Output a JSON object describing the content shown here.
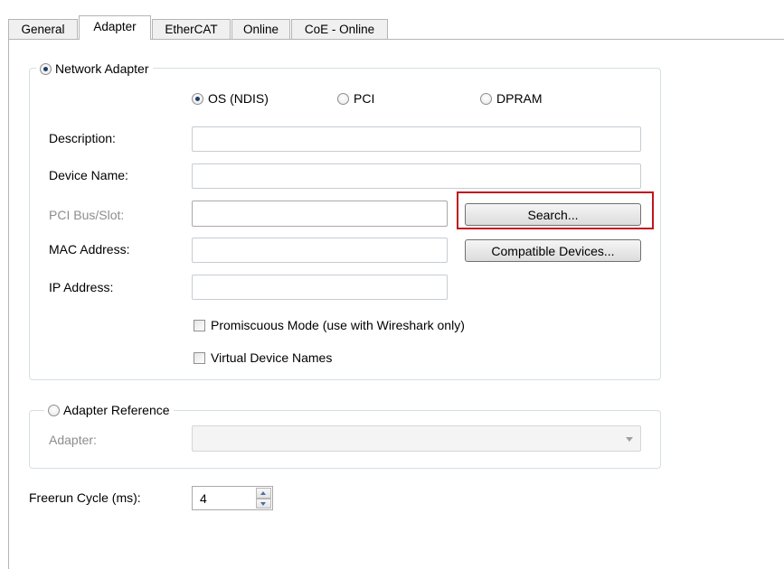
{
  "tabs": [
    {
      "label": "General"
    },
    {
      "label": "Adapter"
    },
    {
      "label": "EtherCAT"
    },
    {
      "label": "Online"
    },
    {
      "label": "CoE - Online"
    }
  ],
  "active_tab": "Adapter",
  "network_adapter": {
    "legend": "Network Adapter",
    "selected": true,
    "mode_options": [
      {
        "label": "OS (NDIS)",
        "selected": true
      },
      {
        "label": "PCI",
        "selected": false
      },
      {
        "label": "DPRAM",
        "selected": false
      }
    ],
    "description_label": "Description:",
    "description_value": "",
    "device_name_label": "Device Name:",
    "device_name_value": "",
    "pci_bus_slot_label": "PCI Bus/Slot:",
    "pci_bus_slot_value": "",
    "mac_address_label": "MAC Address:",
    "mac_address_value": "",
    "ip_address_label": "IP Address:",
    "ip_address_value": "",
    "search_button": "Search...",
    "compatible_devices_button": "Compatible Devices...",
    "promiscuous_mode_label": "Promiscuous Mode (use with Wireshark only)",
    "promiscuous_mode_checked": false,
    "virtual_device_names_label": "Virtual Device Names",
    "virtual_device_names_checked": false
  },
  "adapter_reference": {
    "legend": "Adapter Reference",
    "selected": false,
    "adapter_label": "Adapter:",
    "adapter_value": ""
  },
  "freerun": {
    "label": "Freerun Cycle (ms):",
    "value": "4"
  },
  "colors": {
    "highlight": "#c0161d",
    "disabled_text": "#8d8d8d"
  }
}
